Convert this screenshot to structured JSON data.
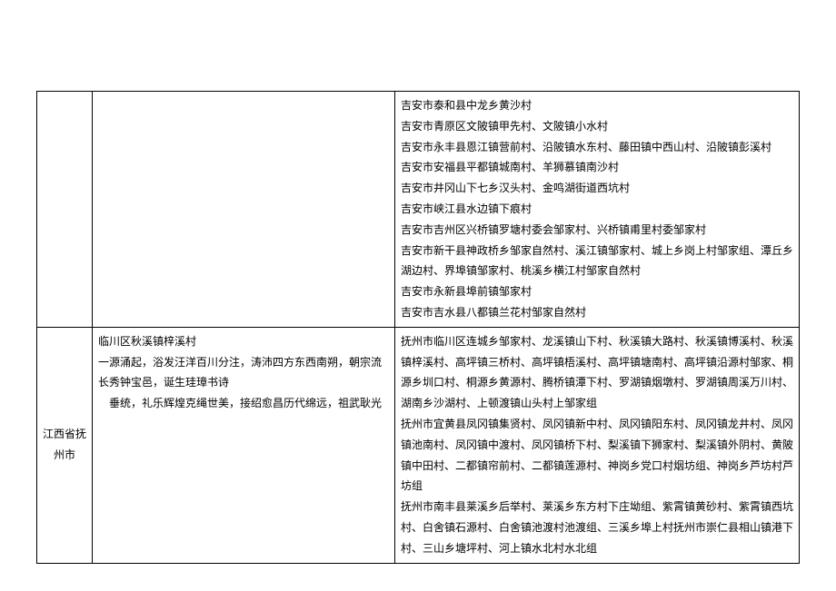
{
  "row1": {
    "col1": "",
    "col2": "",
    "items": [
      "吉安市泰和县中龙乡黄沙村",
      "吉安市青原区文陂镇甲先村、文陂镇小水村",
      "吉安市永丰县恩江镇营前村、沿陂镇水东村、藤田镇中西山村、沿陂镇彭溪村",
      "吉安市安福县平都镇城南村、羊狮慕镇南沙村",
      "吉安市井冈山下七乡汉头村、金鸣湖街道西坑村",
      "吉安市峡江县水边镇下痕村",
      "吉安市吉州区兴桥镇罗塘村委会邹家村、兴桥镇甫里村委邹家村",
      "吉安市新干县神政桥乡邹家自然村、溪江镇邹家村、城上乡岗上村邹家组、潭丘乡湖边村、界埠镇邹家村、桃溪乡横江村邹家自然村",
      "吉安市永新县埠前镇邹家村",
      "吉安市吉水县八都镇兰花村邹家自然村"
    ]
  },
  "row2": {
    "col1": "江西省抚州市",
    "desc_title": "临川区秋溪镇梓溪村",
    "desc_line1": "一源涌起，浴发汪洋百川分注，涛沛四方东西南朔，朝宗流长秀钟宝邑，诞生珪璋书诗",
    "desc_line2": "垂统，礼乐辉煌克绳世美，接绍愈昌历代绵远，祖武耿光",
    "items": [
      "抚州市临川区连城乡邹家村、龙溪镇山下村、秋溪镇大路村、秋溪镇博溪村、秋溪镇梓溪村、高坪镇三桥村、高坪镇梧溪村、高坪镇塘南村、高坪镇沿源村邹家、桐源乡圳口村、桐源乡黄源村、腾桥镇潭下村、罗湖镇烟墩村、罗湖镇周溪万川村、湖南乡沙湖村、上顿渡镇山头村上邹家组",
      "抚州市宜黄县凤冈镇集贤村、凤冈镇新中村、凤冈镇阳东村、凤冈镇龙井村、凤冈镇池南村、凤冈镇中渡村、凤冈镇桥下村、梨溪镇下狮家村、梨溪镇外阴村、黄陂镇中田村、二都镇帘前村、二都镇莲源村、神岗乡党口村烟坊组、神岗乡芦坊村芦坊组",
      "抚州市南丰县莱溪乡后举村、莱溪乡东方村下庄坳组、紫霄镇黄砂村、紫霄镇西坑村、白舍镇石源村、白舍镇池渡村池渡组、三溪乡埠上村抚州市崇仁县相山镇港下村、三山乡塘坪村、河上镇水北村水北组"
    ]
  }
}
